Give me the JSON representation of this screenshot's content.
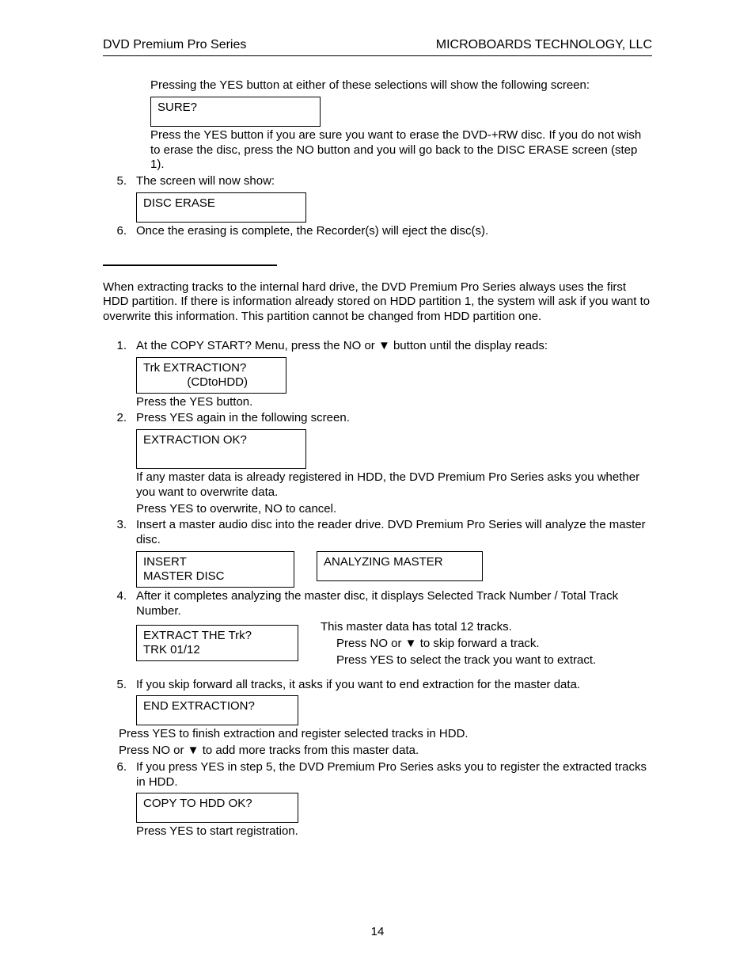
{
  "header": {
    "left": "DVD Premium Pro Series",
    "right": "MICROBOARDS TECHNOLOGY, LLC"
  },
  "intro": {
    "p1": "Pressing the YES button at either of these selections will show the following screen:",
    "box1": "SURE?",
    "p2": "Press the YES button if you are sure you want to erase the DVD-+RW disc.  If you do not wish to erase the disc, press the NO button and you will go back to the DISC ERASE screen (step 1)."
  },
  "listA": {
    "item5": {
      "num": "5.",
      "text": "The screen will now show:",
      "box": "DISC ERASE"
    },
    "item6": {
      "num": "6.",
      "text": "Once the erasing is complete, the Recorder(s) will eject the disc(s)."
    }
  },
  "mid": "When extracting tracks to the internal hard drive, the DVD Premium Pro Series always uses the first HDD partition.  If there is information already stored on HDD partition 1, the system will ask if you want to overwrite this information.  This partition cannot be changed from HDD partition one.",
  "listB": {
    "item1": {
      "num": "1.",
      "text": "At the COPY START? Menu, press the NO or ▼ button until the display reads:",
      "box_l1": "Trk EXTRACTION?",
      "box_l2": "(CDtoHDD)",
      "after": "Press the YES button."
    },
    "item2": {
      "num": "2.",
      "text": "Press YES again in the following screen.",
      "box": "EXTRACTION OK?",
      "after1": "If any master data is already registered in HDD, the DVD Premium Pro Series asks you whether you want to overwrite data.",
      "after2": "Press YES to overwrite, NO to cancel."
    },
    "item3": {
      "num": "3.",
      "text": "Insert a master audio disc into the reader drive. DVD Premium Pro Series will analyze the master disc.",
      "box1_l1": "INSERT",
      "box1_l2": "MASTER DISC",
      "box2": "ANALYZING MASTER"
    },
    "item4": {
      "num": "4.",
      "text": "After it completes analyzing the master disc, it displays Selected Track Number / Total Track Number.",
      "box_l1": "EXTRACT THE Trk?",
      "box_l2": "TRK 01/12",
      "side1": "This master data has total 12 tracks.",
      "side2": "Press NO or ▼ to skip forward a track.",
      "side3": "Press YES to select the track you want to extract."
    },
    "item5": {
      "num": "5.",
      "text": "If you skip forward all tracks, it asks if you want to end extraction for the master data.",
      "box": "END EXTRACTION?",
      "after1": "Press YES to finish extraction and register selected tracks in HDD.",
      "after2": "Press NO or ▼ to add more tracks from this master data."
    },
    "item6": {
      "num": "6.",
      "text": "If you press YES in step 5, the DVD Premium Pro Series asks you to register the extracted tracks in HDD.",
      "box": "COPY TO HDD OK?",
      "after": "Press YES to start registration."
    }
  },
  "pagenum": "14"
}
